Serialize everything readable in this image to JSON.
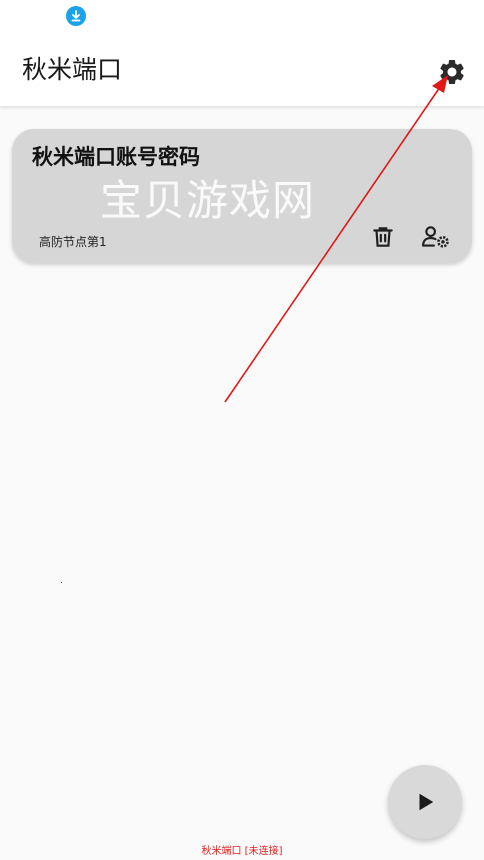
{
  "status_bar": {
    "notification_icon": "download-icon"
  },
  "app_bar": {
    "title": "秋米端口",
    "settings_icon": "gear-icon"
  },
  "card": {
    "title": "秋米端口账号密码",
    "watermark": "宝贝游戏网",
    "subtitle": "高防节点第1",
    "delete_icon": "trash-icon",
    "user_settings_icon": "user-gear-icon"
  },
  "fab": {
    "icon": "play-icon"
  },
  "footer": {
    "status_text": "秋米端口 [未连接]"
  },
  "colors": {
    "annotation_arrow": "#e01818",
    "status_text": "#e0201d",
    "card_background": "#d6d6d6",
    "download_badge": "#1aa3e8"
  }
}
